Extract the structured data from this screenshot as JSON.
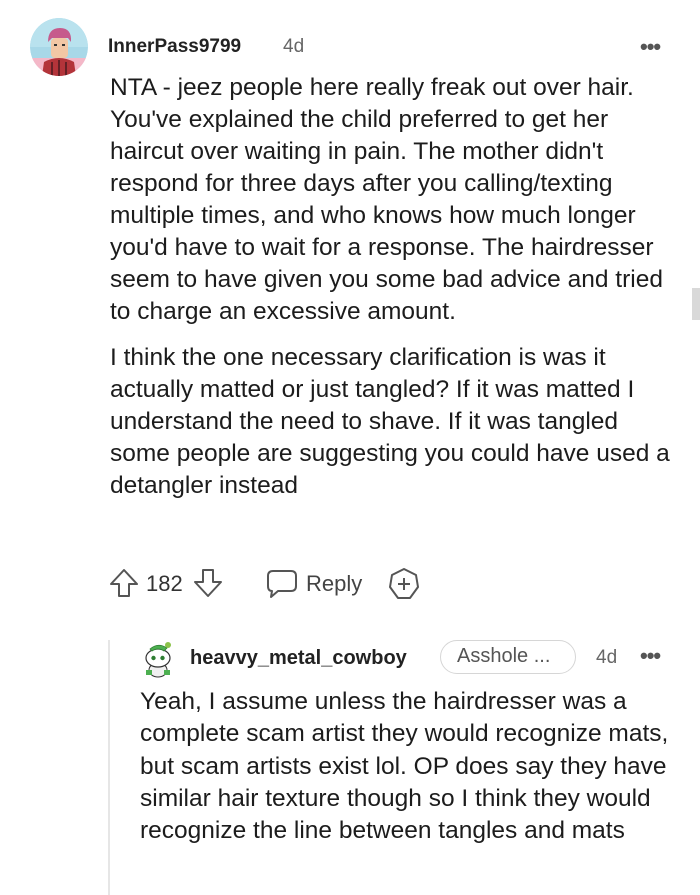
{
  "comment": {
    "author": "InnerPass9799",
    "time": "4d",
    "more_label": "•••",
    "paragraphs": [
      "NTA - jeez people here really freak out over hair. You've explained the child preferred to get her haircut over waiting in pain. The mother didn't respond for three days after you calling/texting multiple times, and who knows how much longer you'd have to wait for a response. The hairdresser seem to have given you some bad advice and tried to charge an excessive amount.",
      "I think the one necessary clarification is was it actually matted or just tangled? If it was matted I understand the need to shave. If it was tangled some people are suggesting you could have used a detangler instead"
    ],
    "actions": {
      "vote_count": "182",
      "reply_label": "Reply",
      "upvote_icon": "upvote-arrow-icon",
      "downvote_icon": "downvote-arrow-icon",
      "reply_icon": "speech-bubble-icon",
      "award_icon": "award-plus-icon"
    }
  },
  "reply": {
    "author": "heavvy_metal_cowboy",
    "flair": "Asshole ...",
    "time": "4d",
    "more_label": "•••",
    "body": "Yeah, I assume unless the hairdresser was a complete scam artist they would recognize mats, but scam artists exist lol. OP does say they have similar hair texture though so I think they would recognize the line between tangles and mats"
  },
  "colors": {
    "avatar_main_bg": "#a8d8e8",
    "avatar_reply_bg": "#ffffff",
    "icon_gray": "#555555"
  }
}
